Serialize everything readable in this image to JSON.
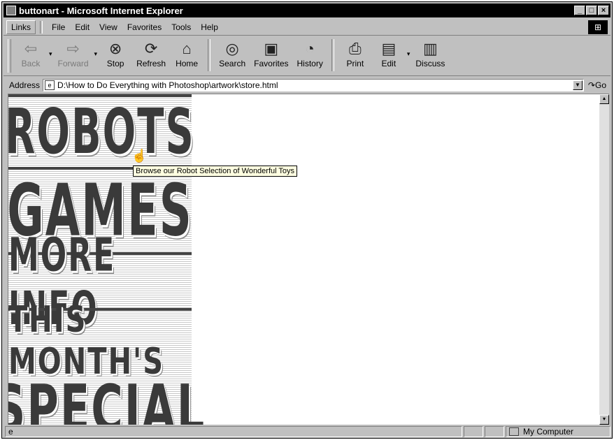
{
  "window": {
    "title": "buttonart - Microsoft Internet Explorer",
    "buttons": [
      "_",
      "□",
      "×"
    ]
  },
  "menubar": {
    "links": "Links",
    "items": [
      "File",
      "Edit",
      "View",
      "Favorites",
      "Tools",
      "Help"
    ]
  },
  "toolbar": {
    "back": "Back",
    "forward": "Forward",
    "stop": "Stop",
    "refresh": "Refresh",
    "home": "Home",
    "search": "Search",
    "favorites": "Favorites",
    "history": "History",
    "print": "Print",
    "edit": "Edit",
    "discuss": "Discuss"
  },
  "address": {
    "label": "Address",
    "value": "D:\\How to Do Everything with Photoshop\\artwork\\store.html",
    "go": "Go"
  },
  "page": {
    "buttons": {
      "robots": "ROBOTS",
      "games": "GAMES",
      "more_info": "MORE INFO",
      "this_months": "THIS MONTH'S",
      "special": "SPECIAL"
    },
    "tooltip": "Browse our Robot Selection of Wonderful Toys"
  },
  "status": {
    "zone": "My Computer"
  }
}
